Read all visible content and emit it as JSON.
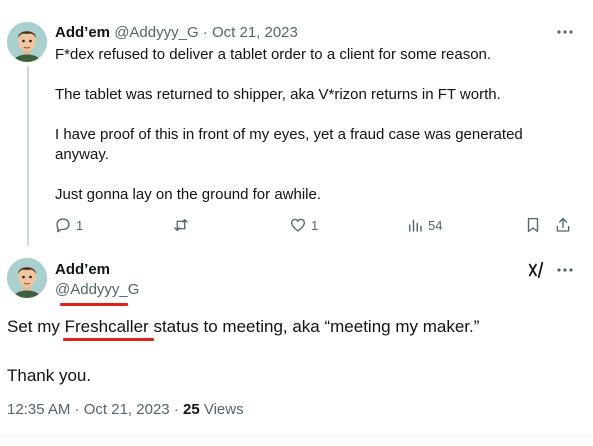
{
  "colors": {
    "text_primary": "#0f1419",
    "text_secondary": "#536471",
    "annotation_red": "#e0201c",
    "thread_line": "#cfd9de"
  },
  "tweet1": {
    "display_name": "Add’em",
    "handle": "@Addyyy_G",
    "separator": "·",
    "date": "Oct 21, 2023",
    "avatar_icon": "cartoon-avatar-icon",
    "more_icon": "more-horizontal-icon",
    "paragraphs": [
      "F*dex refused to deliver a tablet order to a client for some reason.",
      "The tablet was returned to shipper, aka V*rizon returns in FT worth.",
      "I have proof of this in front of my eyes, yet a fraud case was generated anyway.",
      "Just gonna lay on the ground for awhile."
    ],
    "actions": {
      "reply": {
        "icon": "reply-icon",
        "count": "1"
      },
      "retweet": {
        "icon": "retweet-icon",
        "count": ""
      },
      "like": {
        "icon": "like-icon",
        "count": "1"
      },
      "views": {
        "icon": "views-icon",
        "count": "54"
      },
      "bookmark": {
        "icon": "bookmark-icon"
      },
      "share": {
        "icon": "share-icon"
      }
    }
  },
  "tweet2": {
    "display_name": "Add’em",
    "handle": "@Addyyy_G",
    "avatar_icon": "cartoon-avatar-icon",
    "grok_icon": "grok-icon",
    "more_icon": "more-horizontal-icon",
    "text_before": "Set my ",
    "text_highlight": "Freshcaller",
    "text_after": " status to meeting, aka “meeting my maker.”",
    "text_line2": "Thank you.",
    "time": "12:35 AM",
    "separator": "·",
    "date": "Oct 21, 2023",
    "separator2": "·",
    "views_count": "25",
    "views_label": "Views"
  }
}
